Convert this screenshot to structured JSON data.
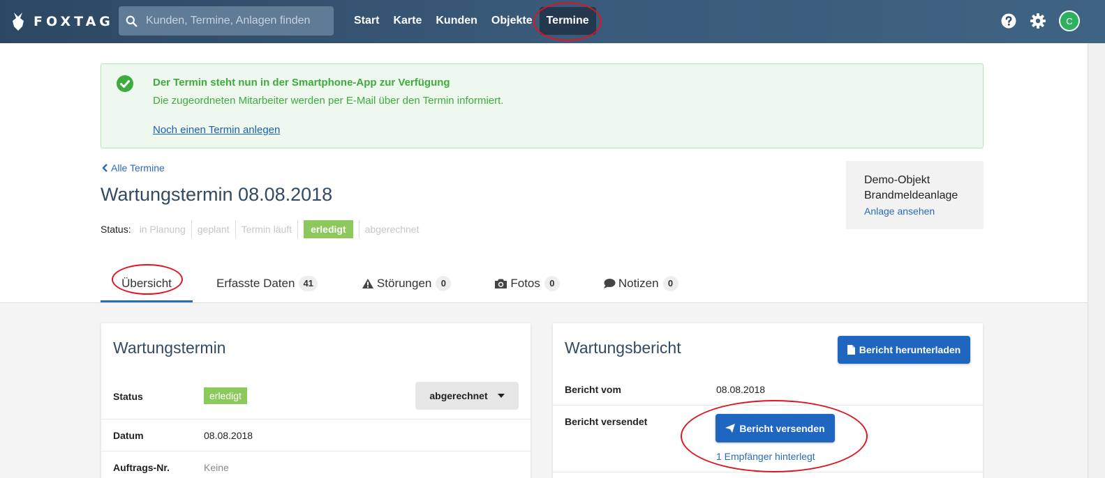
{
  "brand": {
    "name": "FOXTAG"
  },
  "search": {
    "placeholder": "Kunden, Termine, Anlagen finden"
  },
  "nav": {
    "items": [
      "Start",
      "Karte",
      "Kunden",
      "Objekte",
      "Termine"
    ],
    "active": "Termine"
  },
  "user": {
    "initial": "C"
  },
  "alert": {
    "title": "Der Termin steht nun in der Smartphone-App zur Verfügung",
    "text": "Die zugeordneten Mitarbeiter werden per E-Mail über den Termin informiert.",
    "link": "Noch einen Termin anlegen"
  },
  "back_link": "Alle Termine",
  "page_title": "Wartungstermin 08.08.2018",
  "status": {
    "label": "Status:",
    "steps": [
      "in Planung",
      "geplant",
      "Termin läuft",
      "erledigt",
      "abgerechnet"
    ],
    "active": "erledigt"
  },
  "object": {
    "line1": "Demo-Objekt",
    "line2": "Brandmeldeanlage",
    "link": "Anlage ansehen"
  },
  "tabs": [
    {
      "label": "Übersicht",
      "count": null
    },
    {
      "label": "Erfasste Daten",
      "count": "41"
    },
    {
      "label": "Störungen",
      "count": "0"
    },
    {
      "label": "Fotos",
      "count": "0"
    },
    {
      "label": "Notizen",
      "count": "0"
    }
  ],
  "left_card": {
    "title": "Wartungstermin",
    "rows": [
      {
        "label": "Status",
        "value": "erledigt"
      },
      {
        "label": "Datum",
        "value": "08.08.2018"
      },
      {
        "label": "Auftrags-Nr.",
        "value": "Keine"
      }
    ],
    "dropdown": "abgerechnet"
  },
  "right_card": {
    "title": "Wartungsbericht",
    "download_btn": "Bericht herunterladen",
    "rows": [
      {
        "label": "Bericht vom",
        "value": "08.08.2018"
      },
      {
        "label": "Bericht versendet",
        "value": ""
      }
    ],
    "send_btn": "Bericht versenden",
    "recipients_link": "1 Empfänger hinterlegt"
  },
  "colors": {
    "nav_bg": "#2c4763",
    "accent": "#1f66c1",
    "success": "#3eab3e",
    "badge": "#8dc85d",
    "annotation": "#e0141e"
  }
}
